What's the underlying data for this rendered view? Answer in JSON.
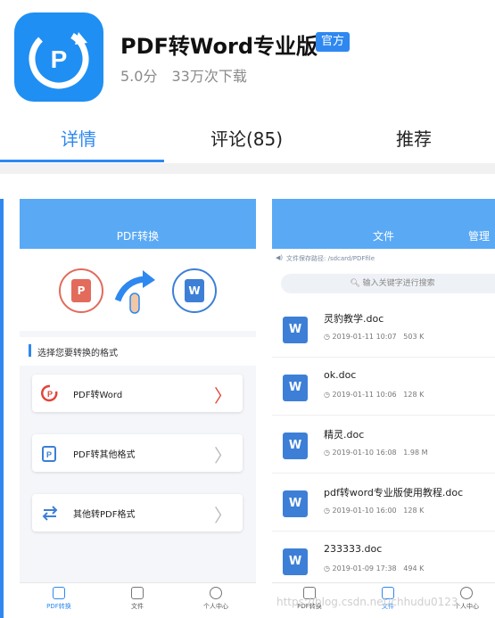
{
  "app": {
    "title": "PDF转Word专业版",
    "badge": "官方",
    "rating": "5.0分",
    "downloads": "33万次下载",
    "icon_letter": "P"
  },
  "tabs": [
    {
      "label": "详情",
      "active": true
    },
    {
      "label": "评论(85)",
      "active": false
    },
    {
      "label": "推荐",
      "active": false
    }
  ],
  "screenshot_left": {
    "title": "PDF转换",
    "section_label": "选择您要转换的格式",
    "options": [
      {
        "label": "PDF转Word"
      },
      {
        "label": "PDF转其他格式"
      },
      {
        "label": "其他转PDF格式"
      }
    ],
    "nav": [
      {
        "label": "PDF转换",
        "active": true
      },
      {
        "label": "文件",
        "active": false
      },
      {
        "label": "个人中心",
        "active": false
      }
    ]
  },
  "screenshot_right": {
    "title": "文件",
    "manage": "管理",
    "path": "文件保存路径: /sdcard/PDFfile",
    "search_placeholder": "输入关键字进行搜索",
    "files": [
      {
        "name": "灵豹教学.doc",
        "date": "2019-01-11 10:07",
        "size": "503 K"
      },
      {
        "name": "ok.doc",
        "date": "2019-01-11 10:06",
        "size": "128 K"
      },
      {
        "name": "精灵.doc",
        "date": "2019-01-10 16:08",
        "size": "1.98 M"
      },
      {
        "name": "pdf转word专业版使用教程.doc",
        "date": "2019-01-10 16:00",
        "size": "128 K"
      },
      {
        "name": "233333.doc",
        "date": "2019-01-09 17:38",
        "size": "494 K"
      }
    ],
    "nav": [
      {
        "label": "PDF转换",
        "active": false
      },
      {
        "label": "文件",
        "active": true
      },
      {
        "label": "个人中心",
        "active": false
      }
    ]
  },
  "watermark": "https://blog.csdn.net/chhudu0123",
  "colors": {
    "accent": "#2e88f0",
    "icon_bg": "#1f8ff3",
    "ppt_red": "#e26b5b",
    "word_blue": "#3d7fd6"
  }
}
